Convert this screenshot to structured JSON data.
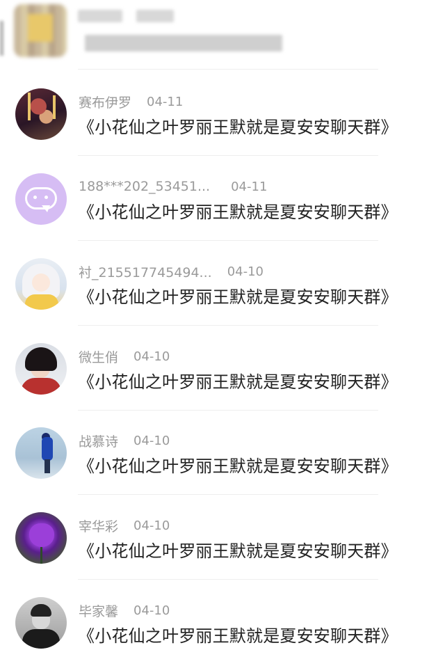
{
  "comments": [
    {
      "name": "赛布伊罗",
      "date": "04-11",
      "message": "《小花仙之叶罗丽王默就是夏安安聊天群》",
      "avatar": "dark-artwork-avatar"
    },
    {
      "name": "188***202_53451...",
      "date": "04-11",
      "message": "《小花仙之叶罗丽王默就是夏安安聊天群》",
      "avatar": "purple-chat-bubble-avatar"
    },
    {
      "name": "衬_215517745494...",
      "date": "04-10",
      "message": "《小花仙之叶罗丽王默就是夏安安聊天群》",
      "avatar": "anime-white-hair-avatar"
    },
    {
      "name": "微生俏",
      "date": "04-10",
      "message": "《小花仙之叶罗丽王默就是夏安安聊天群》",
      "avatar": "anime-red-coat-avatar"
    },
    {
      "name": "战慕诗",
      "date": "04-10",
      "message": "《小花仙之叶罗丽王默就是夏安安聊天群》",
      "avatar": "blue-figure-avatar"
    },
    {
      "name": "宰华彩",
      "date": "04-10",
      "message": "《小花仙之叶罗丽王默就是夏安安聊天群》",
      "avatar": "purple-rose-avatar"
    },
    {
      "name": "毕家馨",
      "date": "04-10",
      "message": "《小花仙之叶罗丽王默就是夏安安聊天群》",
      "avatar": "monochrome-portrait-avatar"
    }
  ],
  "colors": {
    "name_text": "#9a9a9a",
    "message_text": "#222222",
    "divider": "#eeeeee",
    "background": "#ffffff"
  }
}
